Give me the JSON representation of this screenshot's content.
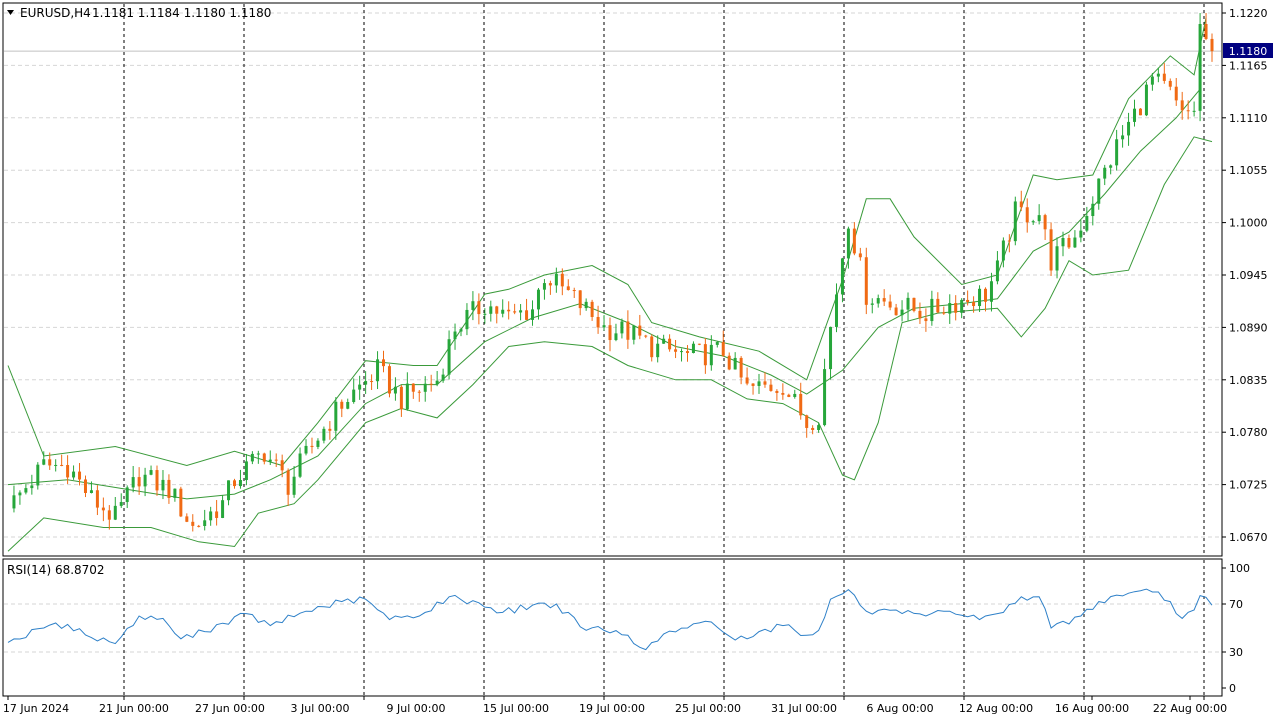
{
  "header": {
    "symbol_label": "EURUSD,H4",
    "ohlc_text": "1.1181 1.1184 1.1180 1.1180"
  },
  "rsi_label": "RSI(14) 68.8702",
  "current_price_badge": "1.1180",
  "colors": {
    "background": "#ffffff",
    "bull_candle": "#26a63a",
    "bear_candle": "#f06a14",
    "bollinger": "#3a9a3a",
    "rsi_line": "#2e80c8",
    "grid": "#d6d6d6",
    "separator": "#000000",
    "price_badge_bg": "#000080",
    "price_badge_text": "#ffffff"
  },
  "chart_data": [
    {
      "type": "candlestick",
      "title": "EURUSD,H4",
      "indicator": "Bollinger Bands",
      "ylim": [
        1.0645,
        1.123
      ],
      "y_ticks": [
        "1.1220",
        "1.1165",
        "1.1110",
        "1.1055",
        "1.1000",
        "1.0945",
        "1.0890",
        "1.0835",
        "1.0780",
        "1.0725",
        "1.0670"
      ],
      "x_ticks": [
        "17 Jun 2024",
        "21 Jun 00:00",
        "27 Jun 00:00",
        "3 Jul 00:00",
        "9 Jul 00:00",
        "15 Jul 00:00",
        "19 Jul 00:00",
        "25 Jul 00:00",
        "31 Jul 00:00",
        "6 Aug 00:00",
        "12 Aug 00:00",
        "16 Aug 00:00",
        "22 Aug 00:00"
      ],
      "grid": true,
      "last_price": 1.118,
      "close_path": [
        {
          "x": 0,
          "y": 1.07
        },
        {
          "x": 6,
          "y": 1.0745
        },
        {
          "x": 10,
          "y": 1.0745
        },
        {
          "x": 14,
          "y": 1.071
        },
        {
          "x": 18,
          "y": 1.069
        },
        {
          "x": 22,
          "y": 1.0735
        },
        {
          "x": 27,
          "y": 1.072
        },
        {
          "x": 31,
          "y": 1.068
        },
        {
          "x": 36,
          "y": 1.0705
        },
        {
          "x": 38,
          "y": 1.073
        },
        {
          "x": 43,
          "y": 1.076
        },
        {
          "x": 47,
          "y": 1.0725
        },
        {
          "x": 52,
          "y": 1.0775
        },
        {
          "x": 56,
          "y": 1.081
        },
        {
          "x": 62,
          "y": 1.0845
        },
        {
          "x": 66,
          "y": 1.0815
        },
        {
          "x": 72,
          "y": 1.0835
        },
        {
          "x": 75,
          "y": 1.089
        },
        {
          "x": 80,
          "y": 1.0915
        },
        {
          "x": 84,
          "y": 1.09
        },
        {
          "x": 88,
          "y": 1.091
        },
        {
          "x": 90,
          "y": 1.0945
        },
        {
          "x": 95,
          "y": 1.092
        },
        {
          "x": 100,
          "y": 1.089
        },
        {
          "x": 104,
          "y": 1.0885
        },
        {
          "x": 108,
          "y": 1.087
        },
        {
          "x": 114,
          "y": 1.086
        },
        {
          "x": 120,
          "y": 1.0865
        },
        {
          "x": 124,
          "y": 1.0825
        },
        {
          "x": 130,
          "y": 1.083
        },
        {
          "x": 134,
          "y": 1.079
        },
        {
          "x": 136,
          "y": 1.08
        },
        {
          "x": 138,
          "y": 1.089
        },
        {
          "x": 141,
          "y": 1.1005
        },
        {
          "x": 144,
          "y": 1.0925
        },
        {
          "x": 148,
          "y": 1.0915
        },
        {
          "x": 154,
          "y": 1.0905
        },
        {
          "x": 158,
          "y": 1.0915
        },
        {
          "x": 164,
          "y": 1.0925
        },
        {
          "x": 166,
          "y": 1.095
        },
        {
          "x": 169,
          "y": 1.101
        },
        {
          "x": 173,
          "y": 1.101
        },
        {
          "x": 175,
          "y": 1.096
        },
        {
          "x": 179,
          "y": 1.0985
        },
        {
          "x": 183,
          "y": 1.104
        },
        {
          "x": 186,
          "y": 1.108
        },
        {
          "x": 190,
          "y": 1.1125
        },
        {
          "x": 192,
          "y": 1.115
        },
        {
          "x": 195,
          "y": 1.1135
        },
        {
          "x": 197,
          "y": 1.111
        },
        {
          "x": 199,
          "y": 1.112
        },
        {
          "x": 200,
          "y": 1.1205
        },
        {
          "x": 202,
          "y": 1.118
        }
      ],
      "upper_band_path": [
        {
          "x": 0,
          "y": 1.085
        },
        {
          "x": 6,
          "y": 1.0755
        },
        {
          "x": 18,
          "y": 1.0765
        },
        {
          "x": 30,
          "y": 1.0745
        },
        {
          "x": 38,
          "y": 1.076
        },
        {
          "x": 46,
          "y": 1.0745
        },
        {
          "x": 52,
          "y": 1.079
        },
        {
          "x": 60,
          "y": 1.0855
        },
        {
          "x": 68,
          "y": 1.085
        },
        {
          "x": 72,
          "y": 1.085
        },
        {
          "x": 80,
          "y": 1.0925
        },
        {
          "x": 84,
          "y": 1.093
        },
        {
          "x": 90,
          "y": 1.0945
        },
        {
          "x": 98,
          "y": 1.0955
        },
        {
          "x": 104,
          "y": 1.0935
        },
        {
          "x": 108,
          "y": 1.0895
        },
        {
          "x": 116,
          "y": 1.088
        },
        {
          "x": 126,
          "y": 1.0865
        },
        {
          "x": 134,
          "y": 1.0835
        },
        {
          "x": 140,
          "y": 1.094
        },
        {
          "x": 144,
          "y": 1.1025
        },
        {
          "x": 148,
          "y": 1.1025
        },
        {
          "x": 152,
          "y": 1.0985
        },
        {
          "x": 160,
          "y": 1.0935
        },
        {
          "x": 166,
          "y": 1.0945
        },
        {
          "x": 172,
          "y": 1.105
        },
        {
          "x": 176,
          "y": 1.1045
        },
        {
          "x": 182,
          "y": 1.105
        },
        {
          "x": 188,
          "y": 1.113
        },
        {
          "x": 195,
          "y": 1.1175
        },
        {
          "x": 199,
          "y": 1.1155
        },
        {
          "x": 201,
          "y": 1.1215
        }
      ],
      "middle_band_path": [
        {
          "x": 0,
          "y": 1.0725
        },
        {
          "x": 10,
          "y": 1.073
        },
        {
          "x": 20,
          "y": 1.072
        },
        {
          "x": 30,
          "y": 1.071
        },
        {
          "x": 38,
          "y": 1.0715
        },
        {
          "x": 44,
          "y": 1.073
        },
        {
          "x": 52,
          "y": 1.0755
        },
        {
          "x": 60,
          "y": 1.081
        },
        {
          "x": 66,
          "y": 1.083
        },
        {
          "x": 72,
          "y": 1.083
        },
        {
          "x": 80,
          "y": 1.0875
        },
        {
          "x": 88,
          "y": 1.09
        },
        {
          "x": 96,
          "y": 1.0915
        },
        {
          "x": 104,
          "y": 1.0895
        },
        {
          "x": 112,
          "y": 1.087
        },
        {
          "x": 120,
          "y": 1.086
        },
        {
          "x": 128,
          "y": 1.084
        },
        {
          "x": 134,
          "y": 1.082
        },
        {
          "x": 140,
          "y": 1.0845
        },
        {
          "x": 146,
          "y": 1.089
        },
        {
          "x": 152,
          "y": 1.091
        },
        {
          "x": 160,
          "y": 1.0915
        },
        {
          "x": 166,
          "y": 1.092
        },
        {
          "x": 172,
          "y": 1.097
        },
        {
          "x": 178,
          "y": 1.099
        },
        {
          "x": 184,
          "y": 1.103
        },
        {
          "x": 190,
          "y": 1.1075
        },
        {
          "x": 196,
          "y": 1.111
        },
        {
          "x": 200,
          "y": 1.114
        }
      ],
      "lower_band_path": [
        {
          "x": 0,
          "y": 1.0655
        },
        {
          "x": 6,
          "y": 1.069
        },
        {
          "x": 16,
          "y": 1.068
        },
        {
          "x": 24,
          "y": 1.068
        },
        {
          "x": 32,
          "y": 1.0665
        },
        {
          "x": 38,
          "y": 1.066
        },
        {
          "x": 42,
          "y": 1.0695
        },
        {
          "x": 48,
          "y": 1.0705
        },
        {
          "x": 52,
          "y": 1.073
        },
        {
          "x": 60,
          "y": 1.079
        },
        {
          "x": 66,
          "y": 1.0805
        },
        {
          "x": 72,
          "y": 1.0795
        },
        {
          "x": 78,
          "y": 1.083
        },
        {
          "x": 84,
          "y": 1.087
        },
        {
          "x": 90,
          "y": 1.0875
        },
        {
          "x": 98,
          "y": 1.087
        },
        {
          "x": 104,
          "y": 1.085
        },
        {
          "x": 112,
          "y": 1.0835
        },
        {
          "x": 118,
          "y": 1.0835
        },
        {
          "x": 124,
          "y": 1.0815
        },
        {
          "x": 130,
          "y": 1.081
        },
        {
          "x": 136,
          "y": 1.079
        },
        {
          "x": 140,
          "y": 1.0735
        },
        {
          "x": 142,
          "y": 1.073
        },
        {
          "x": 146,
          "y": 1.079
        },
        {
          "x": 150,
          "y": 1.0895
        },
        {
          "x": 156,
          "y": 1.0905
        },
        {
          "x": 166,
          "y": 1.091
        },
        {
          "x": 170,
          "y": 1.088
        },
        {
          "x": 174,
          "y": 1.091
        },
        {
          "x": 178,
          "y": 1.096
        },
        {
          "x": 182,
          "y": 1.0945
        },
        {
          "x": 188,
          "y": 1.095
        },
        {
          "x": 194,
          "y": 1.104
        },
        {
          "x": 199,
          "y": 1.109
        },
        {
          "x": 202,
          "y": 1.1085
        }
      ]
    },
    {
      "type": "line",
      "title": "RSI(14) 68.8702",
      "ylim": [
        0,
        100
      ],
      "y_ticks": [
        "100",
        "70",
        "30",
        "0"
      ],
      "grid": true,
      "series": [
        {
          "values": [
            {
              "x": 0,
              "y": 38
            },
            {
              "x": 6,
              "y": 50
            },
            {
              "x": 10,
              "y": 53
            },
            {
              "x": 14,
              "y": 42
            },
            {
              "x": 18,
              "y": 37
            },
            {
              "x": 22,
              "y": 60
            },
            {
              "x": 26,
              "y": 58
            },
            {
              "x": 29,
              "y": 41
            },
            {
              "x": 33,
              "y": 47
            },
            {
              "x": 36,
              "y": 54
            },
            {
              "x": 40,
              "y": 62
            },
            {
              "x": 44,
              "y": 52
            },
            {
              "x": 50,
              "y": 64
            },
            {
              "x": 56,
              "y": 72
            },
            {
              "x": 60,
              "y": 74
            },
            {
              "x": 64,
              "y": 57
            },
            {
              "x": 70,
              "y": 63
            },
            {
              "x": 74,
              "y": 76
            },
            {
              "x": 79,
              "y": 71
            },
            {
              "x": 83,
              "y": 63
            },
            {
              "x": 88,
              "y": 69
            },
            {
              "x": 92,
              "y": 70
            },
            {
              "x": 96,
              "y": 51
            },
            {
              "x": 100,
              "y": 48
            },
            {
              "x": 104,
              "y": 44
            },
            {
              "x": 107,
              "y": 32
            },
            {
              "x": 110,
              "y": 45
            },
            {
              "x": 114,
              "y": 50
            },
            {
              "x": 118,
              "y": 55
            },
            {
              "x": 122,
              "y": 40
            },
            {
              "x": 126,
              "y": 47
            },
            {
              "x": 130,
              "y": 52
            },
            {
              "x": 134,
              "y": 44
            },
            {
              "x": 136,
              "y": 48
            },
            {
              "x": 138,
              "y": 74
            },
            {
              "x": 141,
              "y": 82
            },
            {
              "x": 144,
              "y": 64
            },
            {
              "x": 150,
              "y": 62
            },
            {
              "x": 154,
              "y": 60
            },
            {
              "x": 158,
              "y": 64
            },
            {
              "x": 163,
              "y": 57
            },
            {
              "x": 167,
              "y": 63
            },
            {
              "x": 170,
              "y": 76
            },
            {
              "x": 173,
              "y": 76
            },
            {
              "x": 175,
              "y": 50
            },
            {
              "x": 180,
              "y": 60
            },
            {
              "x": 183,
              "y": 72
            },
            {
              "x": 188,
              "y": 79
            },
            {
              "x": 192,
              "y": 80
            },
            {
              "x": 195,
              "y": 72
            },
            {
              "x": 197,
              "y": 58
            },
            {
              "x": 199,
              "y": 65
            },
            {
              "x": 200,
              "y": 77
            },
            {
              "x": 202,
              "y": 69
            }
          ]
        }
      ]
    }
  ]
}
